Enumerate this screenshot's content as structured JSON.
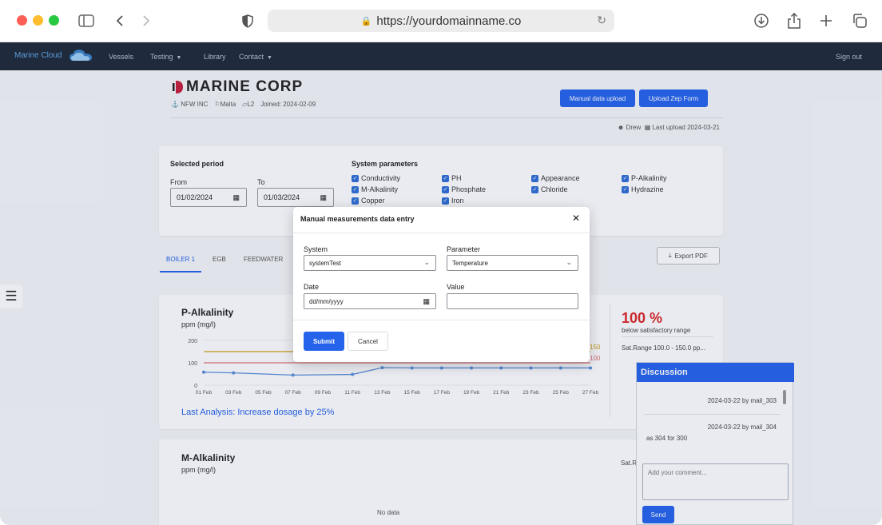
{
  "browser": {
    "url": "https://yourdomainname.co"
  },
  "nav": {
    "brand": "Marine Cloud",
    "items": [
      {
        "label": "Vessels",
        "caret": false
      },
      {
        "label": "Testing",
        "caret": true
      },
      {
        "label": "Library",
        "caret": false
      },
      {
        "label": "Contact",
        "caret": true
      }
    ],
    "signout": "Sign out"
  },
  "header": {
    "company": "MARINE CORP",
    "owner": "NFW INC",
    "flag": "Malta",
    "level": "L2",
    "joined": "Joined: 2024-02-09",
    "btn_manual": "Manual data upload",
    "btn_zep": "Upload Zep Form",
    "user": "Drew",
    "last_upload": "Last upload 2024-03-21"
  },
  "period": {
    "title": "Selected period",
    "from_label": "From",
    "from_value": "01/02/2024",
    "to_label": "To",
    "to_value": "01/03/2024"
  },
  "params": {
    "title": "System parameters",
    "items": [
      "Conductivity",
      "PH",
      "Appearance",
      "P-Alkalinity",
      "M-Alkalinity",
      "Phosphate",
      "Chloride",
      "Hydrazine",
      "Copper",
      "Iron"
    ]
  },
  "tabs": [
    "BOILER 1",
    "EGB",
    "FEEDWATER"
  ],
  "export_label": "Export PDF",
  "chart1": {
    "title": "P-Alkalinity",
    "unit": "ppm (mg/l)",
    "percent": "100 %",
    "range_note": "below satisfactory range",
    "sat_range": "Sat.Range 100.0 - 150.0 pp...",
    "analysis": "Last Analysis: Increase dosage by 25%",
    "line_150": "150",
    "line_100": "100"
  },
  "chart2": {
    "title": "M-Alkalinity",
    "unit": "ppm (mg/l)",
    "empty": "No data",
    "sat_label": "Sat.R"
  },
  "chart_data": {
    "type": "line",
    "x": [
      "01 Feb",
      "03 Feb",
      "05 Feb",
      "07 Feb",
      "09 Feb",
      "11 Feb",
      "13 Feb",
      "15 Feb",
      "17 Feb",
      "19 Feb",
      "21 Feb",
      "23 Feb",
      "25 Feb",
      "27 Feb"
    ],
    "series": [
      {
        "values": [
          58,
          55,
          null,
          45,
          null,
          48,
          78,
          77,
          77,
          77,
          77,
          77,
          77,
          77
        ],
        "color": "#5b8fd8"
      }
    ],
    "ylim": [
      0,
      200
    ],
    "yticks": [
      0,
      100,
      200
    ],
    "reference_lines": [
      {
        "value": 150,
        "color": "#d4a017"
      },
      {
        "value": 100,
        "color": "#e07070"
      }
    ],
    "title": "P-Alkalinity",
    "ylabel": "ppm (mg/l)"
  },
  "discussion": {
    "title": "Discussion",
    "messages": [
      {
        "meta": "2024-03-22 by mail_303",
        "text": ""
      },
      {
        "meta": "2024-03-22 by mail_304",
        "text": "as 304 for 300"
      }
    ],
    "placeholder": "Add your comment...",
    "send": "Send"
  },
  "modal": {
    "title": "Manual measurements data entry",
    "system_label": "System",
    "system_value": "systemTest",
    "parameter_label": "Parameter",
    "parameter_value": "Temperature",
    "date_label": "Date",
    "date_placeholder": "dd/mm/yyyy",
    "value_label": "Value",
    "value_value": "",
    "submit": "Submit",
    "cancel": "Cancel"
  }
}
